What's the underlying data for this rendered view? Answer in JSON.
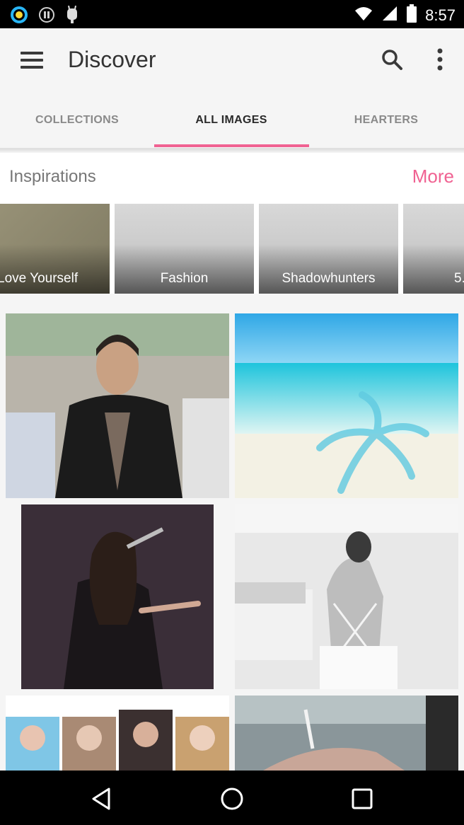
{
  "status_bar": {
    "time": "8:57",
    "left_icons": [
      "app-ring-icon",
      "pause-circle-icon",
      "android-icon"
    ],
    "right_icons": [
      "wifi-icon",
      "signal-icon",
      "battery-icon"
    ]
  },
  "app_bar": {
    "title": "Discover",
    "icons": [
      "menu-icon",
      "search-icon",
      "more-vert-icon"
    ]
  },
  "tabs": [
    {
      "label": "COLLECTIONS",
      "active": false
    },
    {
      "label": "ALL IMAGES",
      "active": true
    },
    {
      "label": "HEARTERS",
      "active": false
    }
  ],
  "accent_color": "#f06292",
  "inspirations": {
    "title": "Inspirations",
    "more_label": "More",
    "items": [
      {
        "label": "Love Yourself"
      },
      {
        "label": "Fashion"
      },
      {
        "label": "Shadowhunters"
      },
      {
        "label": "5..."
      }
    ]
  },
  "grid": {
    "photos": [
      {
        "subject": "man in leather jacket"
      },
      {
        "subject": "tropical beach palm shadow"
      },
      {
        "subject": "singer with microphone"
      },
      {
        "subject": "woman in white room"
      },
      {
        "subject": "group of women selfies"
      },
      {
        "subject": "hand holding cigarette"
      }
    ]
  },
  "nav_bar": {
    "icons": [
      "back-icon",
      "home-icon",
      "recents-icon"
    ]
  }
}
